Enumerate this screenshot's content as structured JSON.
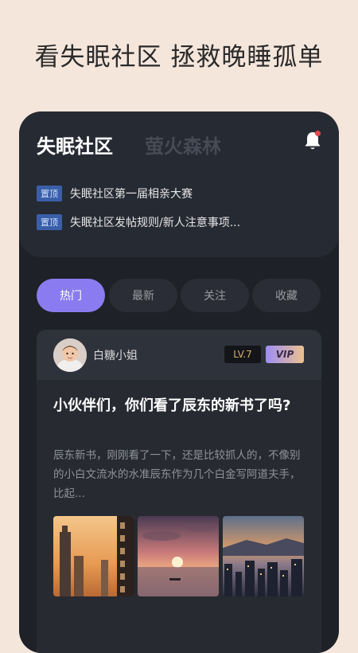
{
  "promo": {
    "headline": "看失眠社区  拯救晚睡孤单"
  },
  "header": {
    "tabs": [
      {
        "label": "失眠社区",
        "active": true
      },
      {
        "label": "萤火森林",
        "active": false
      }
    ],
    "bell_icon": "bell-icon",
    "has_notification": true
  },
  "pinned": [
    {
      "badge": "置顶",
      "text": "失眠社区第一届相亲大赛"
    },
    {
      "badge": "置顶",
      "text": "失眠社区发帖规则/新人注意事项..."
    }
  ],
  "filters": [
    {
      "label": "热门",
      "active": true
    },
    {
      "label": "最新",
      "active": false
    },
    {
      "label": "关注",
      "active": false
    },
    {
      "label": "收藏",
      "active": false
    }
  ],
  "post": {
    "author": "白糖小姐",
    "level": "LV.7",
    "vip": "VIP",
    "title": "小伙伴们，你们看了辰东的新书了吗?",
    "excerpt": "辰东新书，刚刚看了一下，还是比较抓人的，不像别的小白文流水的水准辰东作为几个白金写阿道夫手，比起...",
    "photos": [
      "city-sunset-photo",
      "sea-sunset-photo",
      "harbor-dusk-photo"
    ]
  },
  "colors": {
    "accent": "#8a7cf0",
    "pin_badge": "#3a5fa8",
    "notification_dot": "#e5484d",
    "level_text": "#d3b06a"
  }
}
